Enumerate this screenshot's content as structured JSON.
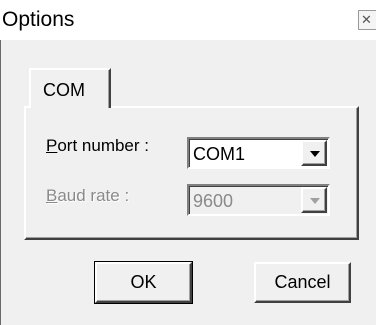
{
  "window": {
    "title": "Options",
    "close_glyph": "✕"
  },
  "tabs": [
    {
      "label": "COM",
      "selected": true
    }
  ],
  "com_panel": {
    "port": {
      "label_mnemonic": "P",
      "label_rest": "ort number :",
      "value": "COM1",
      "enabled": true
    },
    "baud": {
      "label_mnemonic": "B",
      "label_rest": "aud rate :",
      "value": "9600",
      "enabled": false
    }
  },
  "buttons": {
    "ok": "OK",
    "cancel": "Cancel"
  },
  "icons": {
    "close": "close-icon",
    "dropdown": "chevron-down-icon"
  }
}
